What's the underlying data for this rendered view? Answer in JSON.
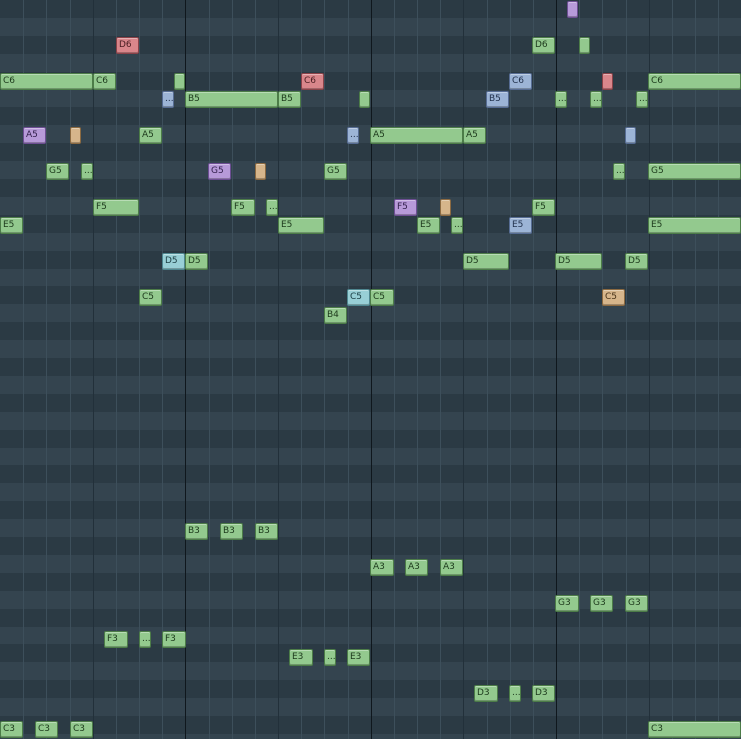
{
  "piano_roll": {
    "colors": {
      "green": "#93c98e",
      "red": "#d9868b",
      "blue": "#9cb4d6",
      "purple": "#b79ad9",
      "tan": "#d6b58b",
      "cyan": "#98cfd6",
      "grid_dark": "#2b3a44",
      "grid_light": "#34444f",
      "bar_line": "#0f171d"
    },
    "notes": [
      {
        "label": "",
        "color": "purple"
      },
      {
        "label": "D6",
        "color": "red"
      },
      {
        "label": "D6",
        "color": "green"
      },
      {
        "label": "",
        "color": "green"
      },
      {
        "label": "C6",
        "color": "green"
      },
      {
        "label": "C6",
        "color": "green"
      },
      {
        "label": "",
        "color": "green"
      },
      {
        "label": "C6",
        "color": "red"
      },
      {
        "label": "C6",
        "color": "blue"
      },
      {
        "label": "",
        "color": "red"
      },
      {
        "label": "C6",
        "color": "green"
      },
      {
        "label": "...",
        "color": "blue"
      },
      {
        "label": "B5",
        "color": "green"
      },
      {
        "label": "B5",
        "color": "green"
      },
      {
        "label": "",
        "color": "green"
      },
      {
        "label": "B5",
        "color": "blue"
      },
      {
        "label": "...",
        "color": "green"
      },
      {
        "label": "...",
        "color": "green"
      },
      {
        "label": "...",
        "color": "green"
      },
      {
        "label": "A5",
        "color": "purple"
      },
      {
        "label": "",
        "color": "tan"
      },
      {
        "label": "A5",
        "color": "green"
      },
      {
        "label": "...",
        "color": "blue"
      },
      {
        "label": "A5",
        "color": "green"
      },
      {
        "label": "A5",
        "color": "green"
      },
      {
        "label": "",
        "color": "blue"
      },
      {
        "label": "G5",
        "color": "green"
      },
      {
        "label": "...",
        "color": "green"
      },
      {
        "label": "G5",
        "color": "purple"
      },
      {
        "label": "",
        "color": "tan"
      },
      {
        "label": "G5",
        "color": "green"
      },
      {
        "label": "...",
        "color": "green"
      },
      {
        "label": "G5",
        "color": "green"
      },
      {
        "label": "F5",
        "color": "green"
      },
      {
        "label": "F5",
        "color": "green"
      },
      {
        "label": "...",
        "color": "green"
      },
      {
        "label": "F5",
        "color": "purple"
      },
      {
        "label": "",
        "color": "tan"
      },
      {
        "label": "F5",
        "color": "green"
      },
      {
        "label": "E5",
        "color": "green"
      },
      {
        "label": "E5",
        "color": "green"
      },
      {
        "label": "E5",
        "color": "green"
      },
      {
        "label": "...",
        "color": "green"
      },
      {
        "label": "E5",
        "color": "blue"
      },
      {
        "label": "E5",
        "color": "green"
      },
      {
        "label": "D5",
        "color": "cyan"
      },
      {
        "label": "D5",
        "color": "green"
      },
      {
        "label": "D5",
        "color": "green"
      },
      {
        "label": "D5",
        "color": "green"
      },
      {
        "label": "D5",
        "color": "green"
      },
      {
        "label": "C5",
        "color": "green"
      },
      {
        "label": "C5",
        "color": "cyan"
      },
      {
        "label": "C5",
        "color": "green"
      },
      {
        "label": "C5",
        "color": "tan"
      },
      {
        "label": "B4",
        "color": "green"
      },
      {
        "label": "B3",
        "color": "green"
      },
      {
        "label": "B3",
        "color": "green"
      },
      {
        "label": "B3",
        "color": "green"
      },
      {
        "label": "A3",
        "color": "green"
      },
      {
        "label": "A3",
        "color": "green"
      },
      {
        "label": "A3",
        "color": "green"
      },
      {
        "label": "G3",
        "color": "green"
      },
      {
        "label": "G3",
        "color": "green"
      },
      {
        "label": "G3",
        "color": "green"
      },
      {
        "label": "F3",
        "color": "green"
      },
      {
        "label": "...",
        "color": "green"
      },
      {
        "label": "F3",
        "color": "green"
      },
      {
        "label": "E3",
        "color": "green"
      },
      {
        "label": "...",
        "color": "green"
      },
      {
        "label": "E3",
        "color": "green"
      },
      {
        "label": "D3",
        "color": "green"
      },
      {
        "label": "...",
        "color": "green"
      },
      {
        "label": "D3",
        "color": "green"
      },
      {
        "label": "C3",
        "color": "green"
      },
      {
        "label": "C3",
        "color": "green"
      },
      {
        "label": "C3",
        "color": "green"
      },
      {
        "label": "C3",
        "color": "green"
      }
    ]
  }
}
